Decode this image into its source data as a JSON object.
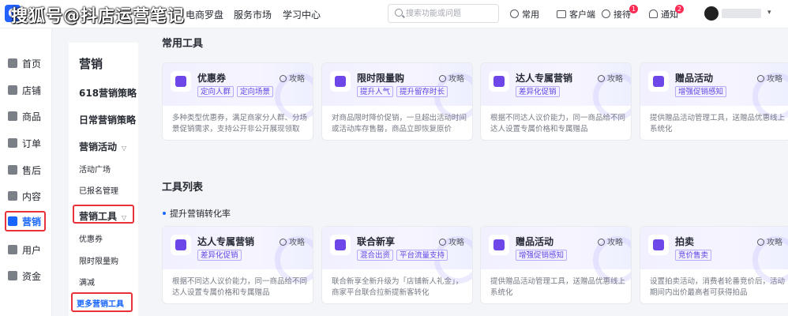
{
  "watermark": "搜狐号@抖店运营笔记",
  "topnav": {
    "items": [
      "电商罗盘",
      "服务市场",
      "学习中心"
    ]
  },
  "search": {
    "placeholder": "搜索功能或问题"
  },
  "topbar": {
    "common": "常用",
    "client": "客户端",
    "reception": "接待",
    "reception_badge": "1",
    "notice": "通知",
    "notice_badge": "2"
  },
  "leftnav": {
    "items": [
      {
        "label": "首页",
        "icon": "home-icon"
      },
      {
        "label": "店铺",
        "icon": "store-icon"
      },
      {
        "label": "商品",
        "icon": "goods-icon"
      },
      {
        "label": "订单",
        "icon": "order-icon"
      },
      {
        "label": "售后",
        "icon": "aftersale-icon"
      },
      {
        "label": "内容",
        "icon": "content-icon"
      },
      {
        "label": "营销",
        "icon": "marketing-icon"
      },
      {
        "label": "用户",
        "icon": "user-icon"
      },
      {
        "label": "资金",
        "icon": "funds-icon"
      }
    ]
  },
  "subnav": {
    "title": "营销",
    "items": [
      "618营销策略",
      "日常营销策略",
      "营销活动",
      "活动广场",
      "已报名管理",
      "营销工具",
      "优惠券",
      "限时限量购",
      "满减",
      "更多营销工具"
    ]
  },
  "sections": {
    "common_tools": "常用工具",
    "tool_list": "工具列表",
    "subsection": "提升营销转化率"
  },
  "guide_label": "攻略",
  "common_cards": [
    {
      "name": "优惠券",
      "tags": [
        "定向人群",
        "定向场景"
      ],
      "desc": "多种类型优惠券，满足商家分人群、分场景促销需求，支持公开非公开展现领取"
    },
    {
      "name": "限时限量购",
      "tags": [
        "提升人气",
        "提升留存时长"
      ],
      "desc": "对商品限时降价促销，一旦超出活动时间或活动库存售罄，商品立即恢复原价"
    },
    {
      "name": "达人专属营销",
      "tags": [
        "差异化促销"
      ],
      "desc": "根据不同达人议价能力，同一商品给不同达人设置专属价格和专属赠品"
    },
    {
      "name": "赠品活动",
      "tags": [
        "增强促销感知"
      ],
      "desc": "提供赠品活动管理工具，送赠品优惠线上系统化"
    }
  ],
  "list_cards": [
    {
      "name": "达人专属营销",
      "tags": [
        "差异化促销"
      ],
      "desc": "根据不同达人议价能力，同一商品给不同达人设置专属价格和专属赠品"
    },
    {
      "name": "联合新享",
      "tags": [
        "混合出资",
        "平台流量支持"
      ],
      "desc": "联合新享全新升级为「店铺新人礼金」，商家平台联合拉新提新客转化"
    },
    {
      "name": "赠品活动",
      "tags": [
        "增强促销感知"
      ],
      "desc": "提供赠品活动管理工具，送赠品优惠线上系统化"
    },
    {
      "name": "拍卖",
      "tags": [
        "竞价售卖"
      ],
      "desc": "设置拍卖活动，消费者轮番竞价后，活动期间内出价最高者可获得拍品"
    }
  ]
}
